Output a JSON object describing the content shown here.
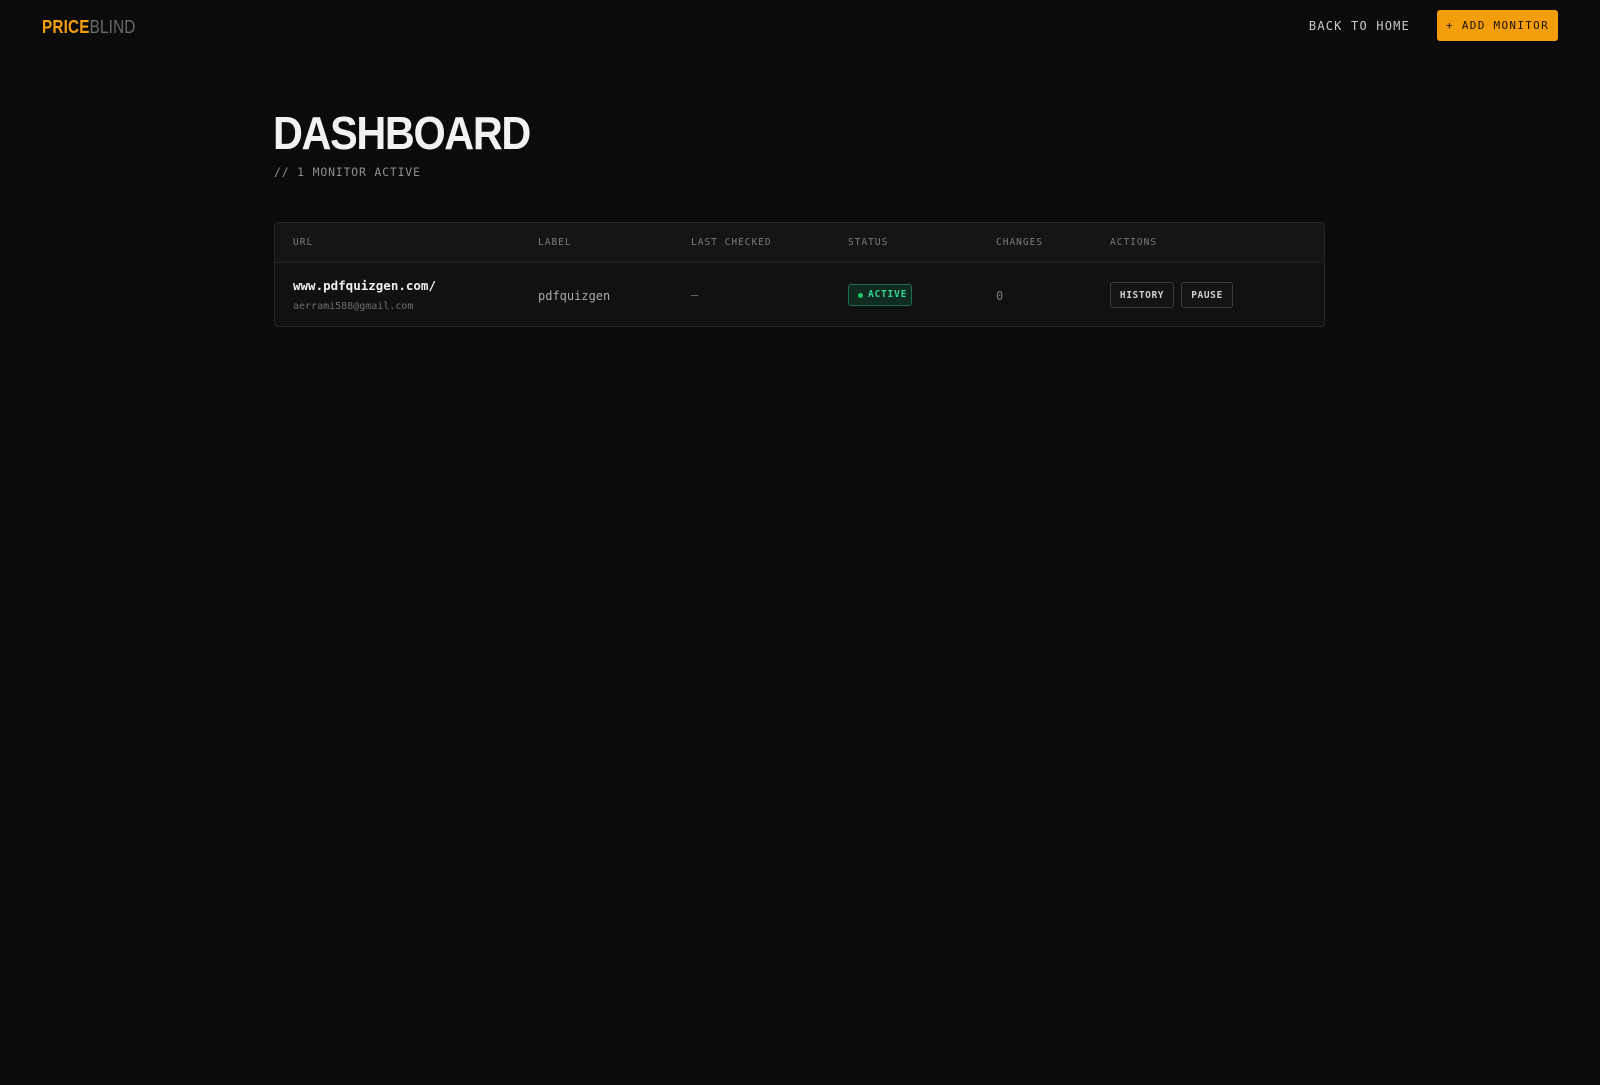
{
  "brand": {
    "name_part1": "PRICE",
    "name_part2": "BLIND",
    "accent_color": "#f59e0b",
    "muted_color": "#6b6b6b"
  },
  "header": {
    "back_link": "BACK TO HOME",
    "add_button": "+ ADD MONITOR"
  },
  "page": {
    "title": "DASHBOARD",
    "subtitle": "// 1 MONITOR ACTIVE"
  },
  "table": {
    "columns": [
      "URL",
      "LABEL",
      "LAST CHECKED",
      "STATUS",
      "CHANGES",
      "ACTIONS"
    ],
    "rows": [
      {
        "url": "www.pdfquizgen.com/",
        "email": "aerrami588@gmail.com",
        "label": "pdfquizgen",
        "last_checked": "—",
        "status": "ACTIVE",
        "status_color": "#22c55e",
        "changes": "0",
        "actions": [
          "HISTORY",
          "PAUSE"
        ]
      }
    ]
  }
}
